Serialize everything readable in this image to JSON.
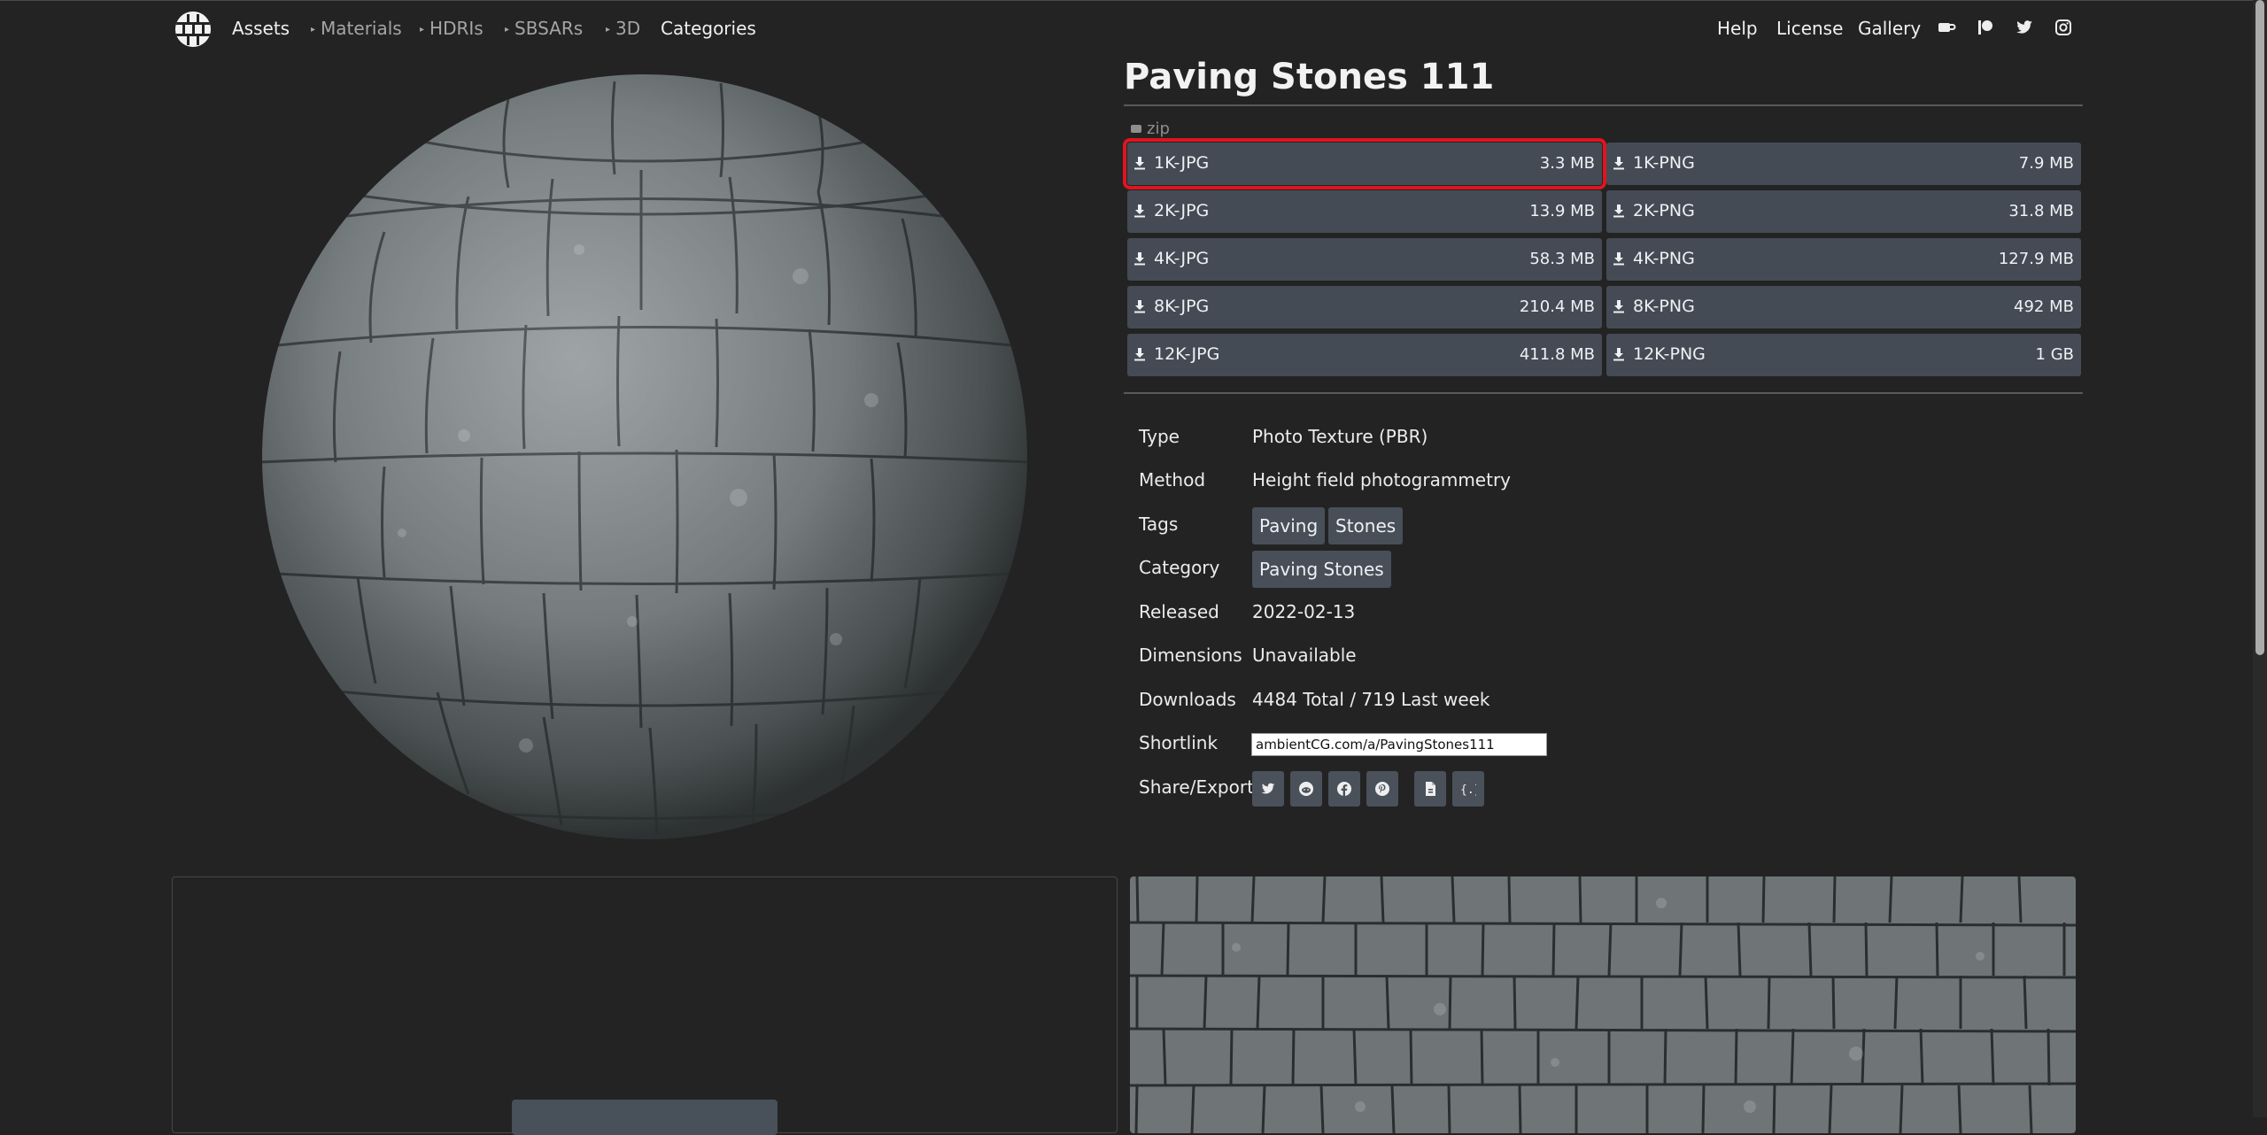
{
  "nav": {
    "assets": "Assets",
    "materials": "Materials",
    "hdris": "HDRIs",
    "sbsars": "SBSARs",
    "threed": "3D",
    "categories": "Categories",
    "help": "Help",
    "license": "License",
    "gallery": "Gallery",
    "icons": [
      "coffee-icon",
      "patreon-icon",
      "twitter-icon",
      "instagram-icon"
    ]
  },
  "asset": {
    "title": "Paving Stones 111",
    "zip_label": "zip"
  },
  "downloads": [
    {
      "label": "1K-JPG",
      "size": "3.3 MB"
    },
    {
      "label": "1K-PNG",
      "size": "7.9 MB"
    },
    {
      "label": "2K-JPG",
      "size": "13.9 MB"
    },
    {
      "label": "2K-PNG",
      "size": "31.8 MB"
    },
    {
      "label": "4K-JPG",
      "size": "58.3 MB"
    },
    {
      "label": "4K-PNG",
      "size": "127.9 MB"
    },
    {
      "label": "8K-JPG",
      "size": "210.4 MB"
    },
    {
      "label": "8K-PNG",
      "size": "492 MB"
    },
    {
      "label": "12K-JPG",
      "size": "411.8 MB"
    },
    {
      "label": "12K-PNG",
      "size": "1 GB"
    }
  ],
  "props": {
    "type_label": "Type",
    "type_value": "Photo Texture (PBR)",
    "method_label": "Method",
    "method_value": "Height field photogrammetry",
    "tags_label": "Tags",
    "tags": [
      "Paving",
      "Stones"
    ],
    "category_label": "Category",
    "category_value": "Paving Stones",
    "released_label": "Released",
    "released_value": "2022-02-13",
    "dimensions_label": "Dimensions",
    "dimensions_value": "Unavailable",
    "downloads_label": "Downloads",
    "downloads_value": "4484 Total / 719 Last week",
    "shortlink_label": "Shortlink",
    "shortlink_value": "ambientCG.com/a/PavingStones111",
    "share_label": "Share/Export"
  },
  "share_icons": [
    "twitter-icon",
    "reddit-icon",
    "facebook-icon",
    "pinterest-icon",
    "file-icon",
    "json-icon"
  ],
  "colors": {
    "background": "#232323",
    "button": "#444b55",
    "highlight": "#e0141e"
  }
}
